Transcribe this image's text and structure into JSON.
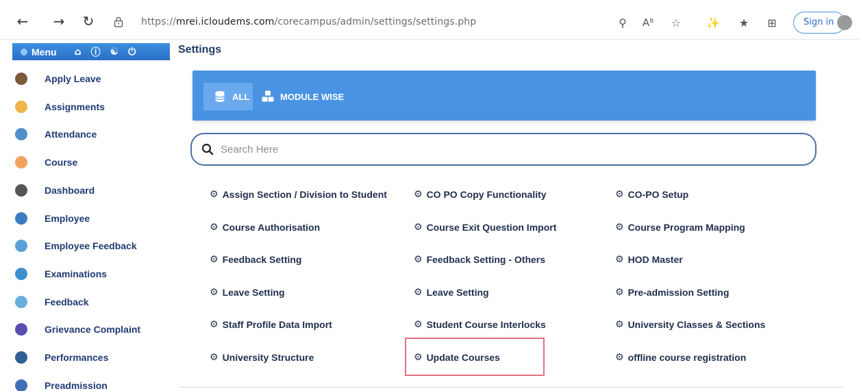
{
  "browser": {
    "url_prefix": "https://",
    "url_host": "mrei.icloudems.com",
    "url_path": "/corecampus/admin/settings/settings.php",
    "signin_label": "Sign in"
  },
  "sidebar": {
    "menu_label": "Menu",
    "items": [
      {
        "label": "Apply Leave",
        "color": "#7c5a3a"
      },
      {
        "label": "Assignments",
        "color": "#f0b44a"
      },
      {
        "label": "Attendance",
        "color": "#4d8fc8"
      },
      {
        "label": "Course",
        "color": "#f2a35e"
      },
      {
        "label": "Dashboard",
        "color": "#555555"
      },
      {
        "label": "Employee",
        "color": "#3d7cc0"
      },
      {
        "label": "Employee Feedback",
        "color": "#5aa0d8"
      },
      {
        "label": "Examinations",
        "color": "#3e8fd0"
      },
      {
        "label": "Feedback",
        "color": "#6aaee0"
      },
      {
        "label": "Grievance Complaint",
        "color": "#5a4fb0"
      },
      {
        "label": "Performances",
        "color": "#2f5f90"
      },
      {
        "label": "Preadmission",
        "color": "#3f6fb8"
      }
    ]
  },
  "main": {
    "title": "Settings",
    "tabs": [
      {
        "label": "ALL"
      },
      {
        "label": "MODULE WISE"
      }
    ],
    "search_placeholder": "Search Here",
    "settings": [
      [
        "Assign Section / Division to Student",
        "CO PO Copy Functionality",
        "CO-PO Setup"
      ],
      [
        "Course Authorisation",
        "Course Exit Question Import",
        "Course Program Mapping"
      ],
      [
        "Feedback Setting",
        "Feedback Setting - Others",
        "HOD Master"
      ],
      [
        "Leave Setting",
        "Leave Setting",
        "Pre-admission Setting"
      ],
      [
        "Staff Profile Data Import",
        "Student Course Interlocks",
        "University Classes & Sections"
      ],
      [
        "University Structure",
        "Update Courses",
        "offline course registration"
      ]
    ]
  },
  "colors": {
    "accent": "#4a93e3",
    "highlight": "#e0707f"
  }
}
